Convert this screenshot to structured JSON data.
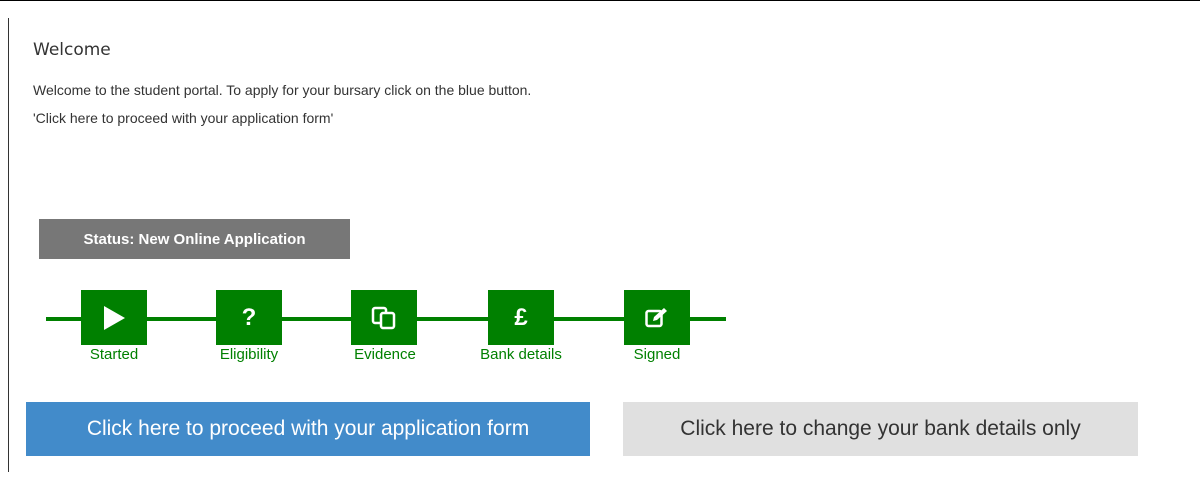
{
  "welcome": {
    "heading": "Welcome",
    "intro": "Welcome to the student portal. To apply for your bursary click on the blue button.",
    "instruction": "'Click here to proceed with your application form'"
  },
  "status": {
    "label": "Status: New Online Application",
    "color": "#777777"
  },
  "progress": {
    "color": "#008000",
    "steps": [
      {
        "label": "Started",
        "icon": "play-icon"
      },
      {
        "label": "Eligibility",
        "icon": "question-icon",
        "glyph": "?"
      },
      {
        "label": "Evidence",
        "icon": "copy-icon"
      },
      {
        "label": "Bank details",
        "icon": "pound-icon",
        "glyph": "£"
      },
      {
        "label": "Signed",
        "icon": "edit-icon"
      }
    ]
  },
  "actions": {
    "proceed_label": "Click here to proceed with your application form",
    "proceed_color": "#428bca",
    "bank_label": "Click here to change your bank details only",
    "bank_color": "#e0e0e0"
  }
}
